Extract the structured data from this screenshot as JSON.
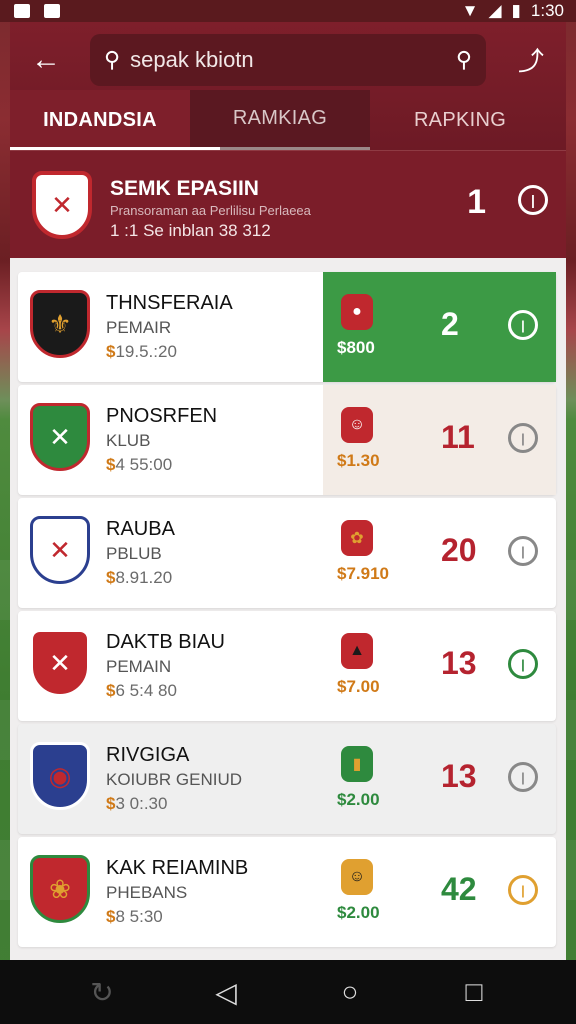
{
  "status_bar": {
    "time": "1:30"
  },
  "search": {
    "value": "sepak kbiotn",
    "back_icon": "arrow-left-icon",
    "search_icon": "search-icon",
    "share_icon": "share-icon"
  },
  "tabs": [
    {
      "label": "INDANDSIA",
      "active": true
    },
    {
      "label": "RAMKIAG",
      "active": false
    },
    {
      "label": "RAPKING",
      "active": false
    }
  ],
  "header": {
    "title": "SEMK EPASIIN",
    "subtitle": "Pransoraman aa Perlilisu Perlaeea",
    "meta": "1 :1 Se inblan 38 312",
    "rank": "1",
    "badge": "(|)"
  },
  "clubs": [
    {
      "name": "THNSFERAIA",
      "type": "PEMAIR",
      "price_prefix": "$",
      "price": "19.5.:20",
      "player_price": "$800",
      "rank": "2",
      "rank_color": "#ffffff",
      "highlight": "green",
      "crest_colors": [
        "#1a1a1a",
        "#c0282e"
      ],
      "badge_color": "#ffffff"
    },
    {
      "name": "PNOSRFEN",
      "type": "KLUB",
      "price_prefix": "$",
      "price": "4 55:00",
      "player_price": "$1.30",
      "rank": "11",
      "rank_color": "#b5232f",
      "highlight": "beige",
      "crest_colors": [
        "#2e8a3e",
        "#c0282e"
      ],
      "badge_color": "#888888"
    },
    {
      "name": "RAUBA",
      "type": "PBLUB",
      "price_prefix": "$",
      "price": "8.91.20",
      "player_price": "$7.910",
      "rank": "20",
      "rank_color": "#b5232f",
      "highlight": "none",
      "crest_colors": [
        "#ffffff",
        "#2b3f8f"
      ],
      "badge_color": "#888888"
    },
    {
      "name": "DAKTB BIAU",
      "type": "PEMAIN",
      "price_prefix": "$",
      "price": "6 5:4 80",
      "player_price": "$7.00",
      "rank": "13",
      "rank_color": "#b5232f",
      "highlight": "none",
      "crest_colors": [
        "#c0282e",
        "#ffffff"
      ],
      "badge_color": "#2e8a3e"
    },
    {
      "name": "RIVGIGA",
      "type": "KOIUBR GENIUD",
      "price_prefix": "$",
      "price": "3 0:.30",
      "player_price": "$2.00",
      "rank": "13",
      "rank_color": "#b5232f",
      "highlight": "none",
      "crest_colors": [
        "#2b3f8f",
        "#c0282e"
      ],
      "badge_color": "#888888"
    },
    {
      "name": "KAK REIAMINB",
      "type": "PHEBANS",
      "price_prefix": "$",
      "price": "8 5:30",
      "player_price": "$2.00",
      "rank": "42",
      "rank_color": "#2e8a3e",
      "highlight": "none",
      "crest_colors": [
        "#c0282e",
        "#2e8a3e"
      ],
      "badge_color": "#e0a030"
    }
  ],
  "nav": {
    "back": "back-icon",
    "home": "home-icon",
    "recent": "recent-apps-icon"
  }
}
